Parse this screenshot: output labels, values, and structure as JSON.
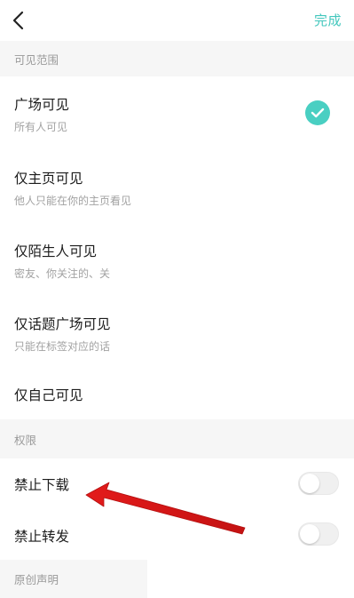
{
  "header": {
    "back_icon": "chevron-left-icon",
    "done_label": "完成"
  },
  "visibility": {
    "section_title": "可见范围",
    "options": [
      {
        "title": "广场可见",
        "subtitle": "所有人可见",
        "selected": true
      },
      {
        "title": "仅主页可见",
        "subtitle": "他人只能在你的主页看见",
        "selected": false
      },
      {
        "title": "仅陌生人可见",
        "subtitle": "密友、你关注的、关",
        "selected": false
      },
      {
        "title": "仅话题广场可见",
        "subtitle": "只能在标签对应的话",
        "selected": false
      },
      {
        "title": "仅自己可见",
        "subtitle": "",
        "selected": false
      }
    ]
  },
  "permissions": {
    "section_title": "权限",
    "items": [
      {
        "title": "禁止下载",
        "enabled": false
      },
      {
        "title": "禁止转发",
        "enabled": false
      }
    ]
  },
  "originality": {
    "section_title": "原创声明"
  },
  "colors": {
    "accent": "#43c7bd",
    "check": "#49cfc2",
    "section_bg": "#f6f6f6",
    "annotation_arrow": "#e31b1b"
  }
}
